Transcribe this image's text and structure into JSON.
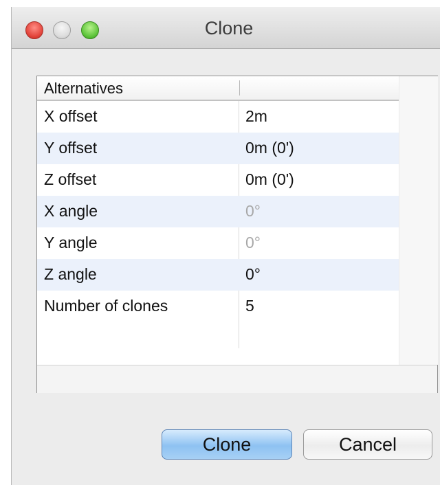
{
  "window": {
    "title": "Clone"
  },
  "table": {
    "columns": [
      "Alternatives",
      ""
    ],
    "rows": [
      {
        "name": "X offset",
        "value": "2m",
        "enabled": true
      },
      {
        "name": "Y offset",
        "value": "0m (0')",
        "enabled": true
      },
      {
        "name": "Z offset",
        "value": "0m (0')",
        "enabled": true
      },
      {
        "name": "X angle",
        "value": "0°",
        "enabled": false
      },
      {
        "name": "Y angle",
        "value": "0°",
        "enabled": false
      },
      {
        "name": "Z angle",
        "value": "0°",
        "enabled": true
      },
      {
        "name": "Number of clones",
        "value": "5",
        "enabled": true
      }
    ]
  },
  "buttons": {
    "clone_label": "Clone",
    "cancel_label": "Cancel"
  },
  "colors": {
    "alt_row": "#ebf1fb",
    "default_button": "#8ec2f2",
    "close_light": "#e2433a",
    "maximize_light": "#5dc43a",
    "disabled_text": "#a8a8a8"
  }
}
